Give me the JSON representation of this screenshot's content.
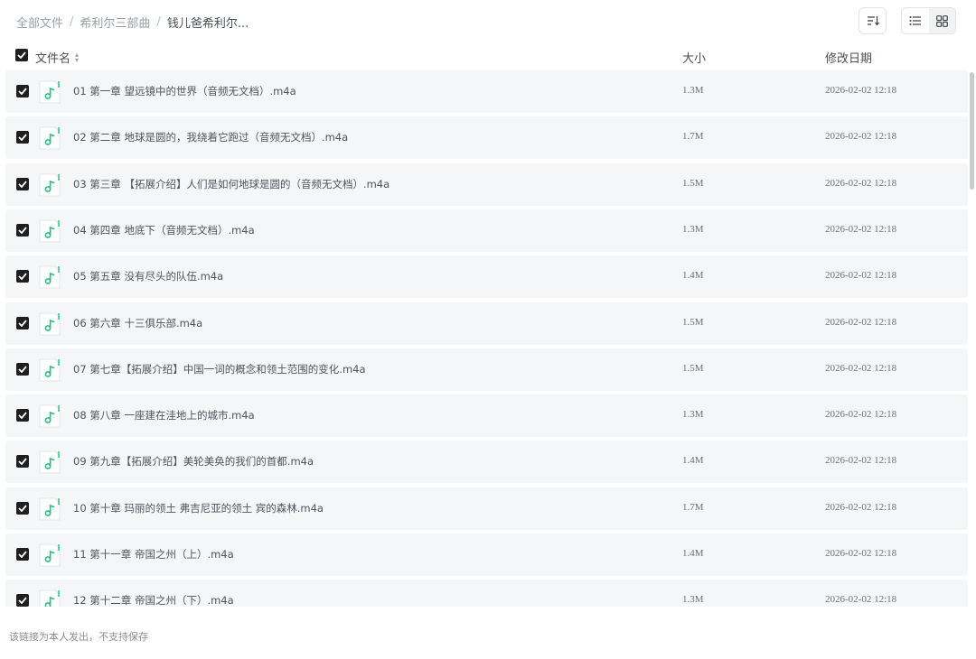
{
  "breadcrumb": {
    "items": [
      "全部文件",
      "希利尔三部曲"
    ],
    "current": "钱儿爸希利尔..."
  },
  "toolbar": {
    "sort_icon": "sort-icon",
    "list_view_icon": "list-view-icon",
    "grid_view_icon": "grid-view-icon"
  },
  "header": {
    "name": "文件名",
    "size": "大小",
    "date": "修改日期"
  },
  "files": [
    {
      "name": "01 第一章 望远镜中的世界（音频无文档）.m4a",
      "size": "1.3M",
      "date": "2026-02-02 12:18"
    },
    {
      "name": "02 第二章 地球是圆的，我绕着它跑过（音频无文档）.m4a",
      "size": "1.7M",
      "date": "2026-02-02 12:18"
    },
    {
      "name": "03 第三章 【拓展介绍】人们是如何地球是圆的（音频无文档）.m4a",
      "size": "1.5M",
      "date": "2026-02-02 12:18"
    },
    {
      "name": "04 第四章 地底下（音频无文档）.m4a",
      "size": "1.3M",
      "date": "2026-02-02 12:18"
    },
    {
      "name": "05 第五章 没有尽头的队伍.m4a",
      "size": "1.4M",
      "date": "2026-02-02 12:18"
    },
    {
      "name": "06 第六章 十三俱乐部.m4a",
      "size": "1.5M",
      "date": "2026-02-02 12:18"
    },
    {
      "name": "07 第七章【拓展介绍】中国一词的概念和领土范围的变化.m4a",
      "size": "1.5M",
      "date": "2026-02-02 12:18"
    },
    {
      "name": "08 第八章 一座建在洼地上的城市.m4a",
      "size": "1.3M",
      "date": "2026-02-02 12:18"
    },
    {
      "name": "09 第九章【拓展介绍】美轮美奂的我们的首都.m4a",
      "size": "1.4M",
      "date": "2026-02-02 12:18"
    },
    {
      "name": "10 第十章 玛丽的领土 弗吉尼亚的领土 宾的森林.m4a",
      "size": "1.7M",
      "date": "2026-02-02 12:18"
    },
    {
      "name": "11 第十一章 帝国之州（上）.m4a",
      "size": "1.4M",
      "date": "2026-02-02 12:18"
    },
    {
      "name": "12 第十二章 帝国之州（下）.m4a",
      "size": "1.3M",
      "date": "2026-02-02 12:18"
    }
  ],
  "footer": {
    "notice": "该链接为本人发出，不支持保存"
  },
  "colors": {
    "accent_green": "#22c07a",
    "row_bg": "#f5f6f7"
  }
}
